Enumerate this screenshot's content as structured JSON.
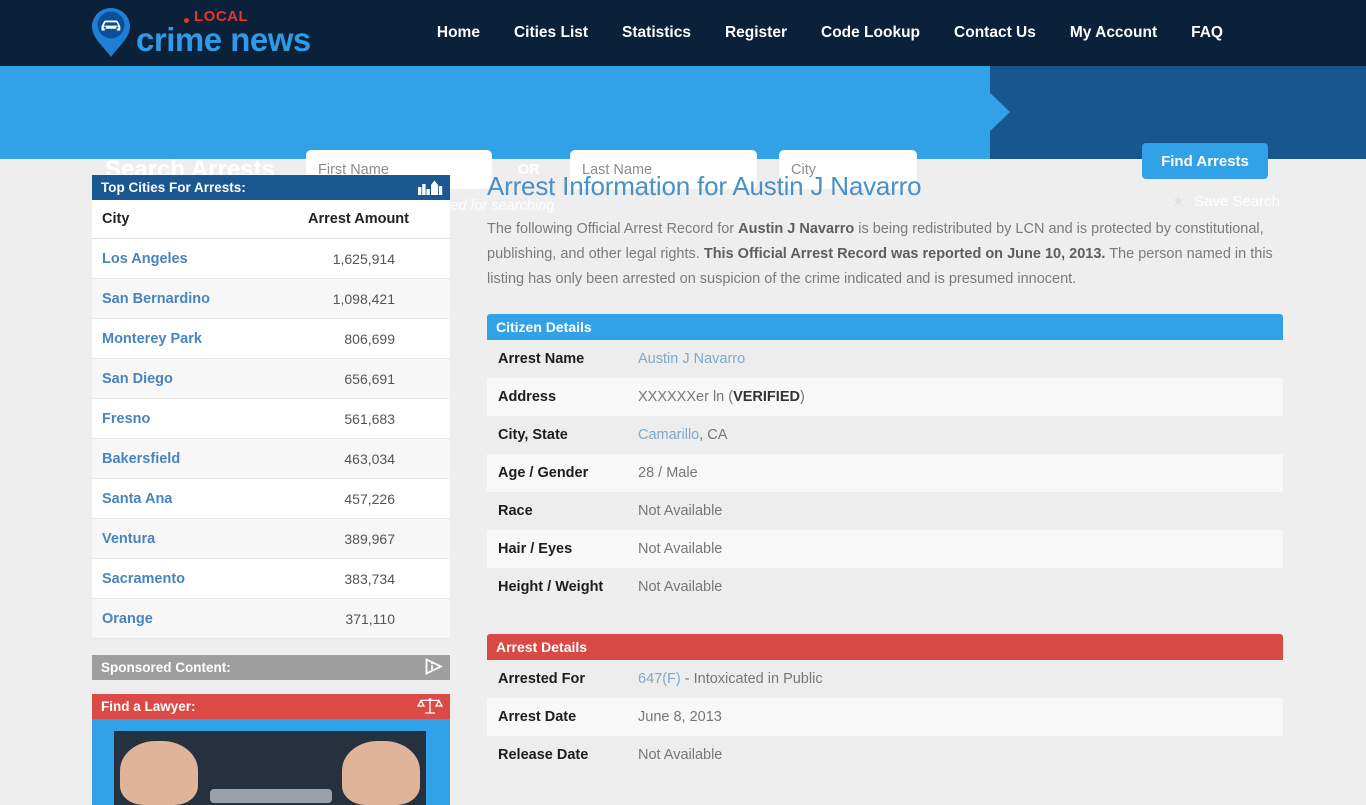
{
  "brand": {
    "local": "LOCAL",
    "name": "crime news",
    "pin_icon": "map-pin-car-icon"
  },
  "nav": {
    "items": [
      {
        "label": "Home"
      },
      {
        "label": "Cities List"
      },
      {
        "label": "Statistics"
      },
      {
        "label": "Register"
      },
      {
        "label": "Code Lookup"
      },
      {
        "label": "Contact Us"
      },
      {
        "label": "My Account"
      },
      {
        "label": "FAQ"
      }
    ]
  },
  "search": {
    "heading": "Search Arrests",
    "first_name_placeholder": "First Name",
    "first_name_value": "",
    "or_label": "OR",
    "last_name_placeholder": "Last Name",
    "last_name_value": "",
    "city_placeholder": "City",
    "city_value": "",
    "hint": "Only one field is required for searching",
    "find_button": "Find Arrests",
    "save_search": "Save Search",
    "star_icon": "star-icon"
  },
  "sidebar": {
    "cities_panel": {
      "title": "Top Cities For Arrests:",
      "icon": "cityscape-icon",
      "col_city": "City",
      "col_amount": "Arrest Amount",
      "rows": [
        {
          "city": "Los Angeles",
          "amount": "1,625,914"
        },
        {
          "city": "San Bernardino",
          "amount": "1,098,421"
        },
        {
          "city": "Monterey Park",
          "amount": "806,699"
        },
        {
          "city": "San Diego",
          "amount": "656,691"
        },
        {
          "city": "Fresno",
          "amount": "561,683"
        },
        {
          "city": "Bakersfield",
          "amount": "463,034"
        },
        {
          "city": "Santa Ana",
          "amount": "457,226"
        },
        {
          "city": "Ventura",
          "amount": "389,967"
        },
        {
          "city": "Sacramento",
          "amount": "383,734"
        },
        {
          "city": "Orange",
          "amount": "371,110"
        }
      ]
    },
    "sponsored_panel": {
      "title": "Sponsored Content:",
      "icon": "adchoices-icon"
    },
    "lawyer_panel": {
      "title": "Find a Lawyer:",
      "icon": "scales-of-justice-icon",
      "image_alt": "handcuffed-hands-photo"
    }
  },
  "main": {
    "page_title": "Arrest Information for Austin J Navarro",
    "intro": {
      "p1": "The following Official Arrest Record for ",
      "subject": "Austin J Navarro",
      "p2": " is being redistributed by LCN and is protected by constitutional, publishing, and other legal rights. ",
      "reported": "This Official Arrest Record was reported on June 10, 2013.",
      "p3": " The person named in this listing has only been arrested on suspicion of the crime indicated and is presumed innocent."
    },
    "citizen_details": {
      "title": "Citizen Details",
      "rows": [
        {
          "label": "Arrest Name",
          "value": "Austin J Navarro",
          "style": "link"
        },
        {
          "label": "Address",
          "value": "XXXXXXer ln (VERIFIED)",
          "style": "address",
          "plain": "XXXXXXer ln (",
          "bold": "VERIFIED",
          "tail": ")"
        },
        {
          "label": "City, State",
          "value": "Camarillo, CA",
          "style": "link-partial",
          "link": "Camarillo",
          "tail": ", CA"
        },
        {
          "label": "Age / Gender",
          "value": "28 / Male",
          "style": "plain"
        },
        {
          "label": "Race",
          "value": "Not Available",
          "style": "plain"
        },
        {
          "label": "Hair / Eyes",
          "value": "Not Available",
          "style": "plain"
        },
        {
          "label": "Height / Weight",
          "value": "Not Available",
          "style": "plain"
        }
      ]
    },
    "arrest_details": {
      "title": "Arrest Details",
      "rows": [
        {
          "label": "Arrested For",
          "value": "647(F) - Intoxicated in Public",
          "style": "link-partial",
          "link": "647(F)",
          "tail": " - Intoxicated in Public"
        },
        {
          "label": "Arrest Date",
          "value": "June 8, 2013",
          "style": "plain"
        },
        {
          "label": "Release Date",
          "value": "Not Available",
          "style": "plain"
        }
      ]
    }
  },
  "colors": {
    "nav_bg": "#0b2039",
    "search_bg": "#32a2e8",
    "search_dark": "#17568f",
    "accent_blue": "#32a2e8",
    "accent_red": "#d94a46",
    "panel_blue": "#1b5791",
    "panel_gray": "#9e9e9e",
    "link_blue": "#4a84bf",
    "page_bg": "#eeeeee"
  }
}
